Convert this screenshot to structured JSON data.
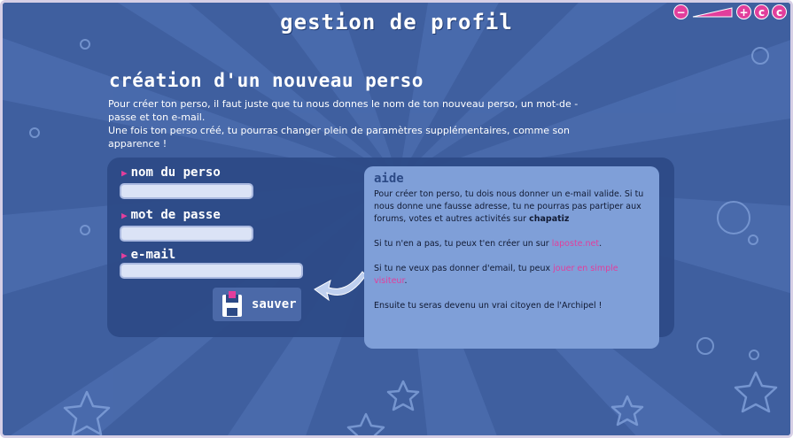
{
  "window": {
    "title": "gestion de profil",
    "controls": [
      "−",
      "+",
      "c",
      "c"
    ]
  },
  "page": {
    "heading": "création d'un nouveau perso",
    "intro": [
      "Pour créer ton perso, il faut juste que tu nous donnes le nom de ton nouveau perso, un mot-de -passe et ton e-mail.",
      "Une fois ton perso créé, tu pourras changer plein de paramètres supplémentaires, comme son apparence !"
    ]
  },
  "form": {
    "name_label": "nom du perso",
    "name_value": "",
    "password_label": "mot de passe",
    "password_value": "",
    "email_label": "e-mail",
    "email_value": "",
    "save_label": "sauver"
  },
  "aide": {
    "title": "aide",
    "p1_text": "Pour créer ton perso, tu dois nous donner un e-mail valide. Si tu nous donne une fausse adresse, tu ne pourras pas partiper aux forums, votes et autres activités sur",
    "p1_bold": "chapatiz",
    "p2_text": "Si tu n'en a pas, tu peux t'en créer un sur",
    "p2_link": "laposte.net",
    "p2_end": ".",
    "p3_text": "Si tu ne veux pas donner d'email, tu peux",
    "p3_link": "jouer en simple visiteur",
    "p3_end": ".",
    "p4_text": "Ensuite tu seras devenu un vrai citoyen de l'Archipel !"
  },
  "colors": {
    "background": "#3f5f9f",
    "accent": "#e23e9c",
    "panel": "#2c4a86",
    "help_box": "#7f9fd8"
  }
}
